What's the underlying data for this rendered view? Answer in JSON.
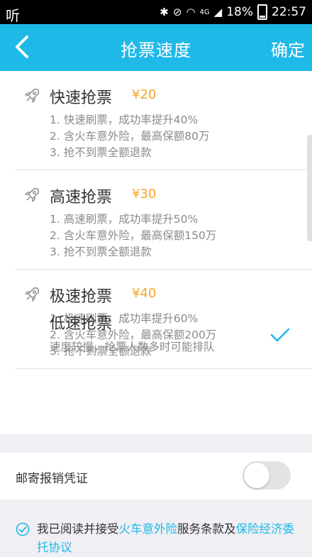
{
  "status_bar": {
    "left_icon_text": "听",
    "network": "4G",
    "battery": "18%",
    "time": "22:57"
  },
  "header": {
    "title": "抢票速度",
    "confirm_label": "确定"
  },
  "options": [
    {
      "name": "快速抢票",
      "price": "¥20",
      "selected": false,
      "features": [
        "1. 快速刷票，成功率提升40%",
        "2. 含火车意外险，最高保额80万",
        "3. 抢不到票全额退款"
      ]
    },
    {
      "name": "高速抢票",
      "price": "¥30",
      "selected": false,
      "features": [
        "1. 高速刷票，成功率提升50%",
        "2. 含火车意外险，最高保额150万",
        "3. 抢不到票全额退款"
      ]
    },
    {
      "name": "极速抢票",
      "price": "¥40",
      "selected": true,
      "features": [
        "1. 极速刷票，成功率提升60%",
        "2. 含火车意外险，最高保额200万",
        "3. 抢不到票全额退款"
      ]
    }
  ],
  "slow_option": {
    "name": "低速抢票",
    "description": "速度较慢，抢票人数多时可能排队"
  },
  "mail_receipt": {
    "label": "邮寄报销凭证",
    "enabled": false
  },
  "agreement": {
    "text_1": "我已阅读并接受",
    "link_1": "火车意外险",
    "text_2": "服务条款及",
    "link_2": "保险经济委托协议",
    "checked": true
  },
  "colors": {
    "accent": "#1fb9e8",
    "price": "#f5a623"
  }
}
